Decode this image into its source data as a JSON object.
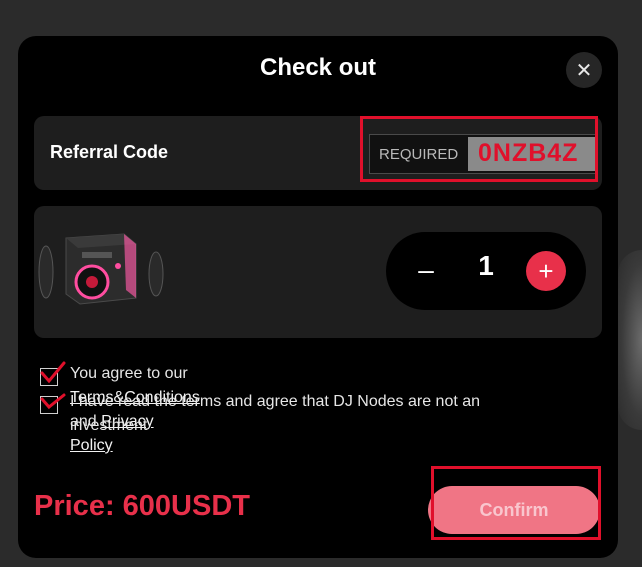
{
  "modal": {
    "title": "Check out",
    "close_icon": "close-icon"
  },
  "referral": {
    "label": "Referral Code",
    "placeholder": "REQUIRED",
    "value": "0NZB4Z"
  },
  "product": {
    "image": "dj-node-device-image",
    "quantity": "1",
    "minus_symbol": "–",
    "plus_symbol": "+"
  },
  "agreements": [
    {
      "prefix": "You agree to our ",
      "link1": "Terms&Conditions",
      "middle": " and ",
      "link2": "Privacy Policy",
      "checked": true
    },
    {
      "text": "I have read the terms and agree that DJ Nodes are not an investment",
      "checked": true
    }
  ],
  "footer": {
    "price": "Price: 600USDT",
    "confirm_label": "Confirm"
  },
  "colors": {
    "accent": "#e8304a",
    "highlight": "#e0102b",
    "panel": "#1e1e1e",
    "modal_bg": "#000000"
  }
}
